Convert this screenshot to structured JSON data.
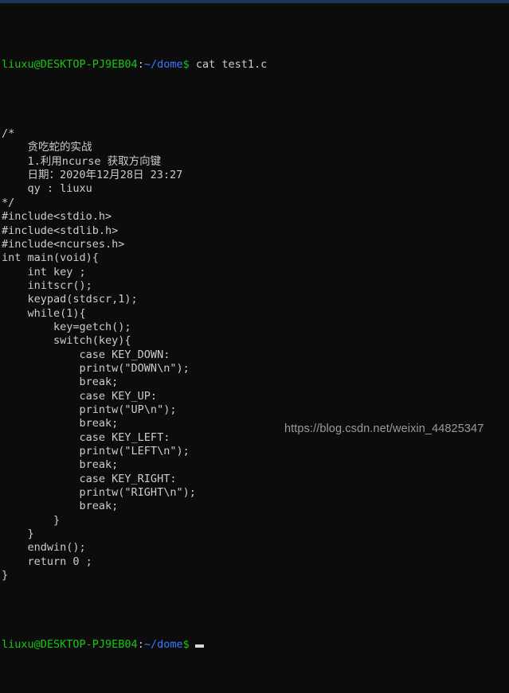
{
  "window": {
    "titlebar_color": "#1d3557",
    "background_color": "#0c0c0c",
    "foreground_color": "#cccccc"
  },
  "colors": {
    "prompt_user_host": "#16c60c",
    "prompt_path": "#3b78ff",
    "prompt_dollar": "#16c60c",
    "output_text": "#cccccc",
    "cursor": "#d8d8d8",
    "watermark": "#9a9a9a"
  },
  "prompt": {
    "user_host": "liuxu@DESKTOP-PJ9EB04",
    "separator": ":",
    "path": "~/dome",
    "symbol": "$",
    "space": " "
  },
  "command": {
    "text": "cat test1.c"
  },
  "file_output": {
    "filename": "test1.c",
    "lines": [
      "/*",
      "    贪吃蛇的实战",
      "    1.利用ncurse 获取方向键",
      "    日期：2020年12月28日 23:27",
      "    qy : liuxu",
      "*/",
      "#include<stdio.h>",
      "#include<stdlib.h>",
      "#include<ncurses.h>",
      "int main(void){",
      "    int key ;",
      "    initscr();",
      "    keypad(stdscr,1);",
      "    while(1){",
      "        key=getch();",
      "        switch(key){",
      "            case KEY_DOWN:",
      "            printw(\"DOWN\\n\");",
      "            break;",
      "            case KEY_UP:",
      "            printw(\"UP\\n\");",
      "            break;",
      "            case KEY_LEFT:",
      "            printw(\"LEFT\\n\");",
      "            break;",
      "            case KEY_RIGHT:",
      "            printw(\"RIGHT\\n\");",
      "            break;",
      "        }",
      "    }",
      "    endwin();",
      "    return 0 ;",
      "}"
    ]
  },
  "watermark": {
    "text": "https://blog.csdn.net/weixin_44825347"
  }
}
